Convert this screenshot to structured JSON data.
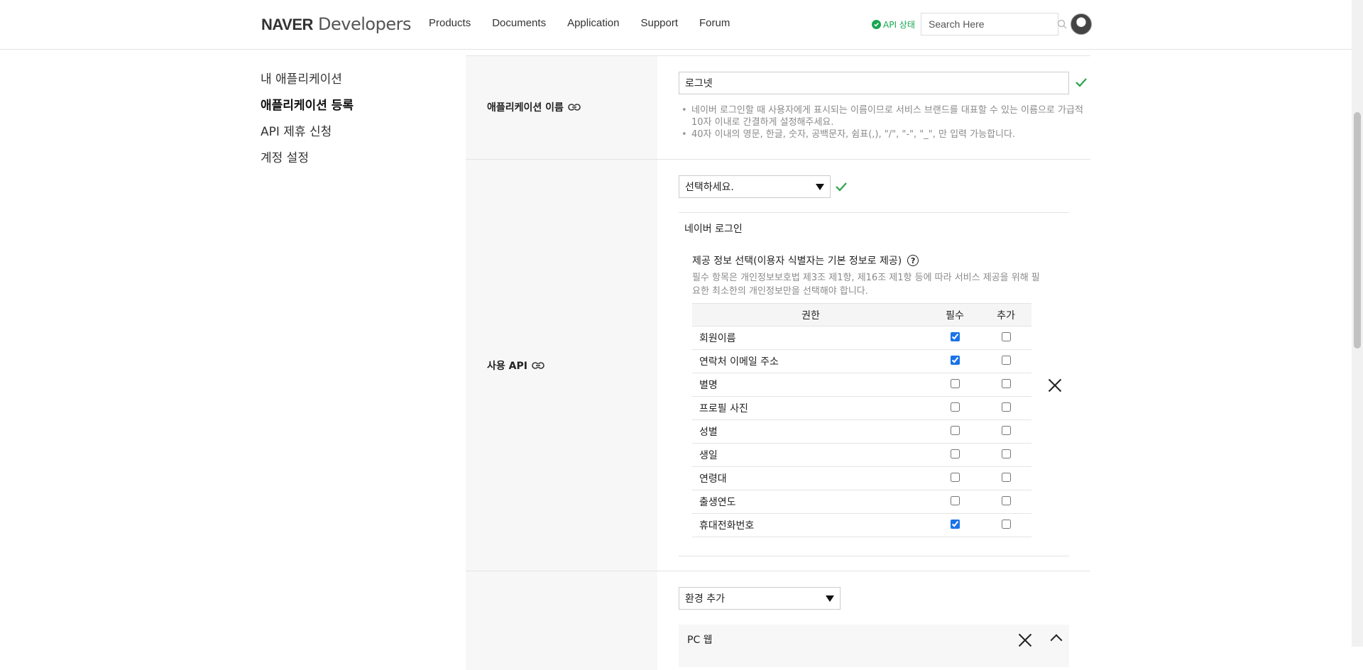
{
  "header": {
    "logo_brand": "NAVER",
    "logo_suffix": " Developers",
    "nav": [
      "Products",
      "Documents",
      "Application",
      "Support",
      "Forum"
    ],
    "api_status": "API 상태",
    "search_placeholder": "Search Here"
  },
  "sidebar": {
    "items": [
      {
        "label": "내 애플리케이션"
      },
      {
        "label": "애플리케이션 등록"
      },
      {
        "label": "API 제휴 신청"
      },
      {
        "label": "계정 설정"
      }
    ],
    "active_index": 1
  },
  "form": {
    "app_name": {
      "label": "애플리케이션 이름",
      "value": "로그넷",
      "hints": [
        "네이버 로그인할 때 사용자에게 표시되는 이름이므로 서비스 브랜드를 대표할 수 있는 이름으로 가급적 10자 이내로 간결하게 설정해주세요.",
        "40자 이내의 영문, 한글, 숫자, 공백문자, 쉼표(,), \"/\", \"-\", \"_\", 만 입력 가능합니다."
      ]
    },
    "api": {
      "label": "사용 API",
      "select_value": "선택하세요.",
      "section_title": "네이버 로그인",
      "info_title": "제공 정보 선택(이용자 식별자는 기본 정보로 제공)",
      "info_desc": "필수 항목은 개인정보보호법 제3조 제1항, 제16조 제1항 등에 따라 서비스 제공을 위해 필요한 최소한의 개인정보만을 선택해야 합니다.",
      "table_headers": {
        "permission": "권한",
        "required": "필수",
        "optional": "추가"
      },
      "permissions": [
        {
          "name": "회원이름",
          "required": true,
          "optional": false
        },
        {
          "name": "연락처 이메일 주소",
          "required": true,
          "optional": false
        },
        {
          "name": "별명",
          "required": false,
          "optional": false
        },
        {
          "name": "프로필 사진",
          "required": false,
          "optional": false
        },
        {
          "name": "성별",
          "required": false,
          "optional": false
        },
        {
          "name": "생일",
          "required": false,
          "optional": false
        },
        {
          "name": "연령대",
          "required": false,
          "optional": false
        },
        {
          "name": "출생연도",
          "required": false,
          "optional": false
        },
        {
          "name": "휴대전화번호",
          "required": true,
          "optional": false
        }
      ]
    },
    "env": {
      "select_value": "환경 추가",
      "env_label": "PC 웹"
    }
  },
  "colors": {
    "accent_green": "#2aa34a",
    "checkbox": "#1a73e8"
  }
}
